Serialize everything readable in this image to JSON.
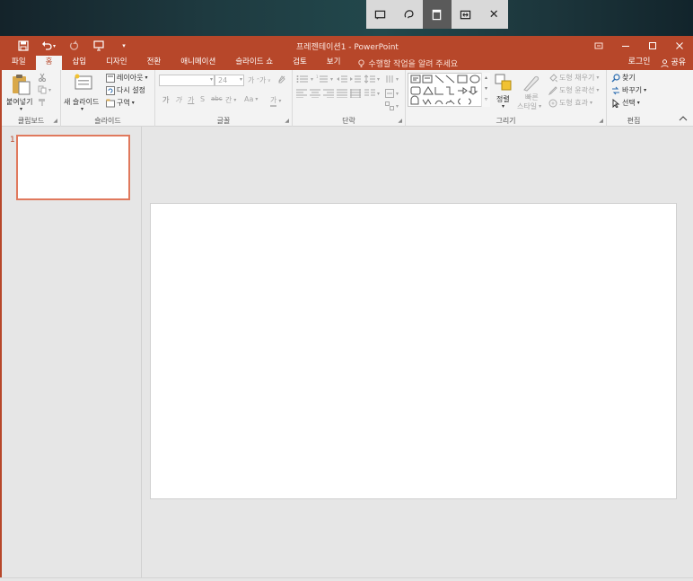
{
  "snip_toolbar": {
    "buttons": [
      {
        "name": "rectangle-snip-icon"
      },
      {
        "name": "freeform-snip-icon"
      },
      {
        "name": "window-snip-icon",
        "active": true
      },
      {
        "name": "fullscreen-snip-icon"
      },
      {
        "name": "close-icon",
        "glyph": "✕"
      }
    ]
  },
  "title": "프레젠테이션1 - PowerPoint",
  "quick_access": {
    "save": "save-icon",
    "undo": "undo-icon",
    "redo": "redo-icon",
    "start_slideshow": "slideshow-icon",
    "customize": "customize-qat-icon"
  },
  "tabs": [
    "파일",
    "홈",
    "삽입",
    "디자인",
    "전환",
    "애니메이션",
    "슬라이드 쇼",
    "검토",
    "보기"
  ],
  "active_tab": "홈",
  "tell_me": "수행할 작업을 알려 주세요",
  "account": {
    "login": "로그인",
    "share": "공유"
  },
  "ribbon": {
    "clipboard": {
      "label": "클립보드",
      "paste": "붙여넣기"
    },
    "slides": {
      "label": "슬라이드",
      "new_slide": "새 슬라이드",
      "layout": "레이아웃",
      "reset": "다시 설정",
      "section": "구역"
    },
    "font": {
      "label": "글꼴",
      "font_name": "",
      "font_size": "24",
      "bold": "가",
      "italic": "가",
      "underline": "가",
      "strike": "abc",
      "spacing": "간",
      "case": "Aa",
      "color": "가"
    },
    "paragraph": {
      "label": "단락"
    },
    "drawing": {
      "label": "그리기",
      "arrange": "정렬",
      "quick_styles_1": "빠른",
      "quick_styles_2": "스타일",
      "fill": "도형 채우기",
      "outline": "도형 윤곽선",
      "effects": "도형 효과"
    },
    "editing": {
      "label": "편집",
      "find": "찾기",
      "replace": "바꾸기",
      "select": "선택"
    }
  },
  "slides": [
    {
      "number": "1"
    }
  ],
  "colors": {
    "accent": "#b7472a",
    "thumb_border": "#e0795d",
    "ribbon_bg": "#f3f3f3",
    "canvas_bg": "#e6e6e6"
  }
}
